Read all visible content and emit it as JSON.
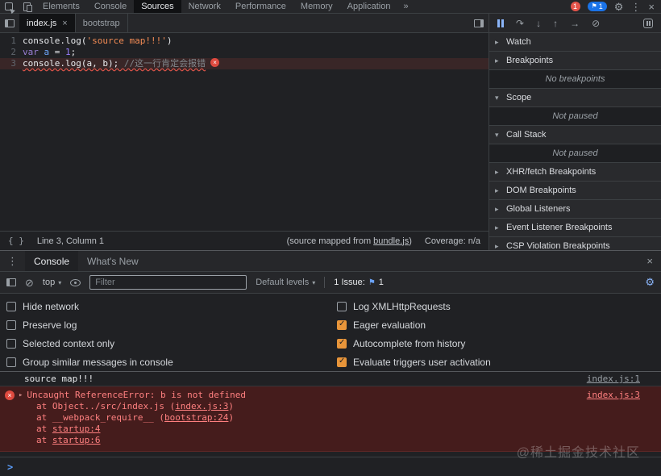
{
  "topbar": {
    "tabs": [
      "Elements",
      "Console",
      "Sources",
      "Network",
      "Performance",
      "Memory",
      "Application"
    ],
    "more_tabs": "»",
    "error_badge": "1",
    "issue_badge": "1"
  },
  "icons": {
    "gear": "⚙",
    "more_vertical": "⋮",
    "close": "×",
    "flag": "⚑",
    "clear_console": "⊘",
    "step_over": "↷",
    "step_into": "↓",
    "step_out": "↑",
    "step": "→",
    "deactivate_breakpoints": "⊘",
    "dropdown_caret": "▾",
    "error_x": "×"
  },
  "sources": {
    "tab_index": "index.js",
    "tab_index_close": "×",
    "tab_bootstrap": "bootstrap",
    "editor": {
      "line_numbers": [
        "1",
        "2",
        "3"
      ],
      "l1_code": "console.log(",
      "l1_string": "'source map!!!'",
      "l1_close": ")",
      "l2_kw": "var ",
      "l2_var": "a",
      "l2_op": " = ",
      "l2_num": "1",
      "l2_semi": ";",
      "l3_code": "console.log(a, b); ",
      "l3_comment": "//这一行肯定会报错"
    },
    "status": {
      "pretty_print": "{ }",
      "position": "Line 3, Column 1",
      "map_pre": "(source mapped from ",
      "map_link": "bundle.js",
      "map_post": ")",
      "coverage": "Coverage: n/a"
    }
  },
  "debugger": {
    "sections": [
      {
        "arrow": "▸",
        "label": "Watch"
      },
      {
        "arrow": "▸",
        "label": "Breakpoints"
      },
      {
        "arrow": "▾",
        "label": "Scope"
      },
      {
        "arrow": "▾",
        "label": "Call Stack"
      },
      {
        "arrow": "▸",
        "label": "XHR/fetch Breakpoints"
      },
      {
        "arrow": "▸",
        "label": "DOM Breakpoints"
      },
      {
        "arrow": "▸",
        "label": "Global Listeners"
      },
      {
        "arrow": "▸",
        "label": "Event Listener Breakpoints"
      },
      {
        "arrow": "▸",
        "label": "CSP Violation Breakpoints"
      }
    ],
    "no_breakpoints": "No breakpoints",
    "not_paused": "Not paused"
  },
  "console": {
    "tab_console": "Console",
    "tab_whats_new": "What's New",
    "context": "top",
    "filter_placeholder": "Filter",
    "levels": "Default levels",
    "issue_label": "1 Issue:",
    "issue_count": "1",
    "settings_left": [
      {
        "label": "Hide network",
        "checked": false
      },
      {
        "label": "Preserve log",
        "checked": false
      },
      {
        "label": "Selected context only",
        "checked": false
      },
      {
        "label": "Group similar messages in console",
        "checked": false
      }
    ],
    "settings_right": [
      {
        "label": "Log XMLHttpRequests",
        "checked": false
      },
      {
        "label": "Eager evaluation",
        "checked": true
      },
      {
        "label": "Autocomplete from history",
        "checked": true
      },
      {
        "label": "Evaluate triggers user activation",
        "checked": true
      }
    ],
    "log1": {
      "text": "source map!!!",
      "link": "index.js:1"
    },
    "error": {
      "expander": "▸",
      "message": "Uncaught ReferenceError: b is not defined",
      "link": "index.js:3",
      "stack": [
        {
          "pre": "at Object../src/index.js (",
          "link": "index.js:3",
          "post": ")"
        },
        {
          "pre": "at __webpack_require__ (",
          "link": "bootstrap:24",
          "post": ")"
        },
        {
          "pre": "at ",
          "link": "startup:4",
          "post": ""
        },
        {
          "pre": "at ",
          "link": "startup:6",
          "post": ""
        }
      ]
    },
    "prompt": ">"
  },
  "watermark": "@稀土掘金技术社区",
  "colors": {
    "accent_blue": "#8ab4f8",
    "checkbox_orange": "#e8953a",
    "error_text": "#ff8080",
    "error_background": "#451c1c",
    "badge_red": "#e5544a",
    "badge_blue": "#1a73e8"
  }
}
